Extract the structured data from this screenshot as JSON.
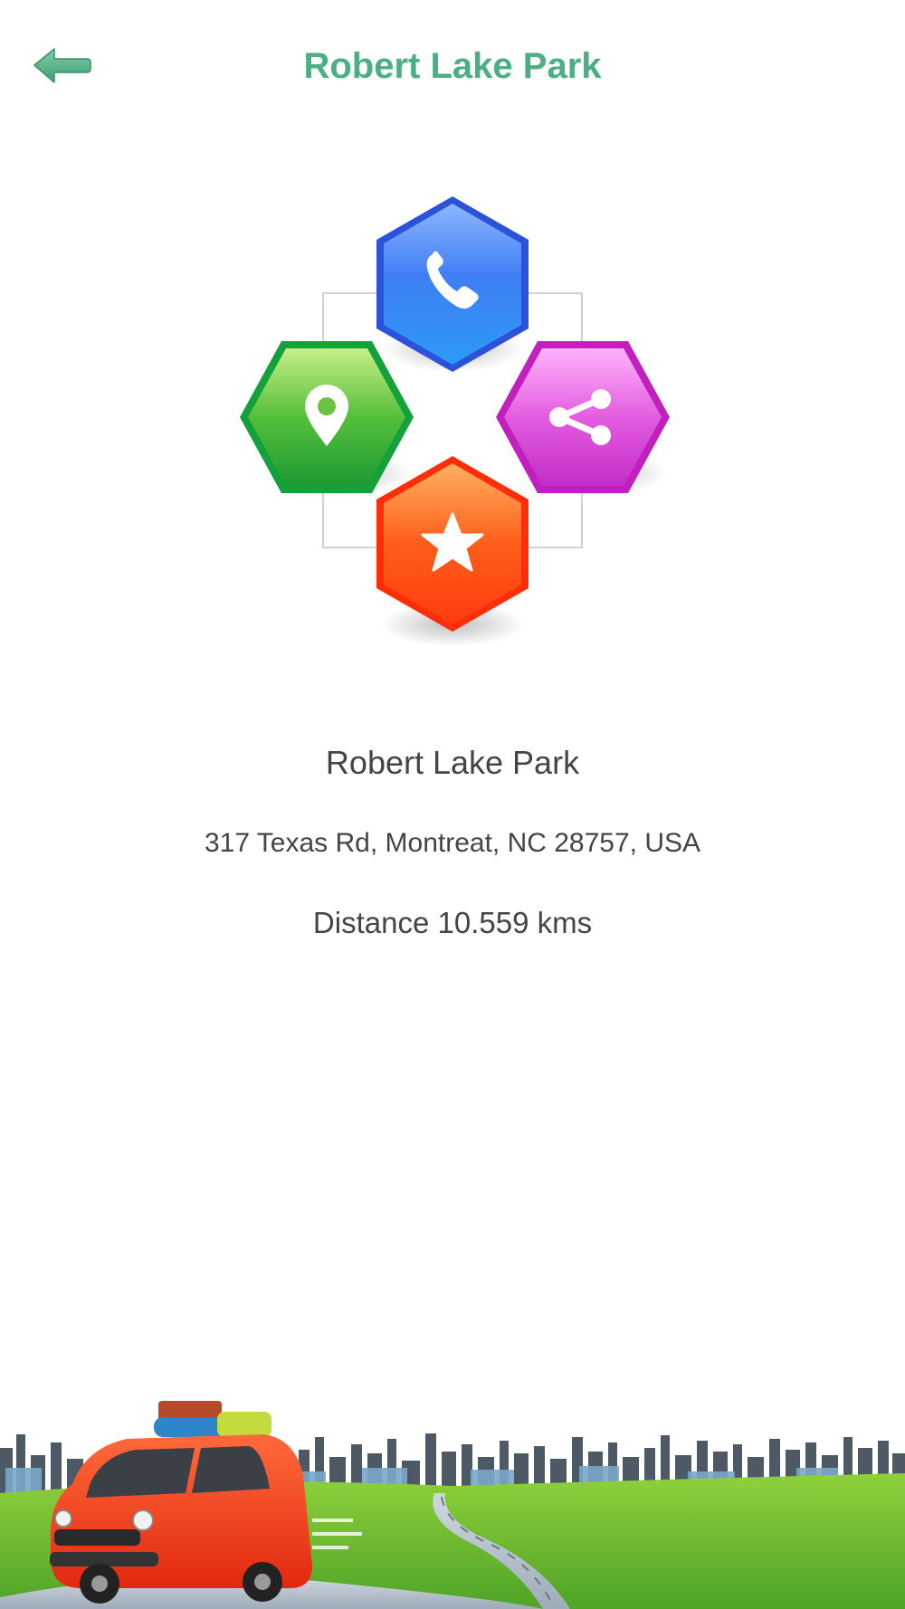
{
  "header": {
    "title": "Robert Lake Park",
    "back_icon": "back-arrow-icon"
  },
  "actions": [
    {
      "icon": "phone-icon",
      "color": "#2f7cf0"
    },
    {
      "icon": "map-pin-icon",
      "color": "#2aa63a"
    },
    {
      "icon": "share-icon",
      "color": "#d93fd4"
    },
    {
      "icon": "star-icon",
      "color": "#ff4d12"
    }
  ],
  "place": {
    "name": "Robert Lake Park",
    "address": "317 Texas Rd, Montreat, NC 28757, USA",
    "distance_label": "Distance",
    "distance_value": "10.559 kms"
  },
  "colors": {
    "accent": "#4cae83",
    "text": "#444444"
  }
}
